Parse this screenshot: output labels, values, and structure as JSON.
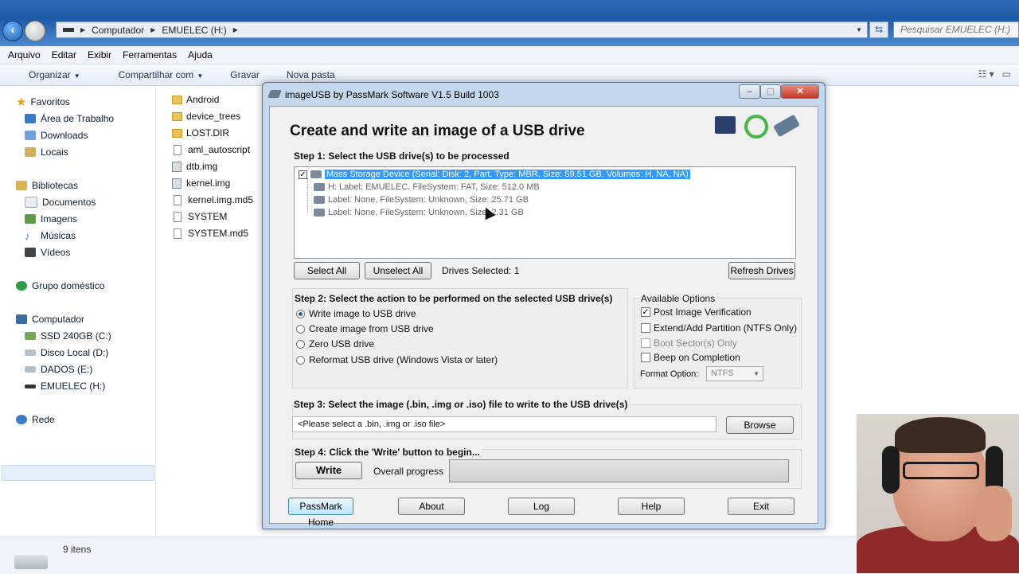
{
  "explorer": {
    "breadcrumb": [
      "Computador",
      "EMUELEC (H:)"
    ],
    "search_placeholder": "Pesquisar EMUELEC (H:)",
    "menu": [
      "Arquivo",
      "Editar",
      "Exibir",
      "Ferramentas",
      "Ajuda"
    ],
    "commands": [
      "Organizar",
      "Compartilhar com",
      "Gravar",
      "Nova pasta"
    ],
    "nav": {
      "favorites": "Favoritos",
      "desktop": "Área de Trabalho",
      "downloads": "Downloads",
      "places": "Locais",
      "libraries": "Bibliotecas",
      "documents": "Documentos",
      "images": "Imagens",
      "music": "Músicas",
      "videos": "Vídeos",
      "homegroup": "Grupo doméstico",
      "computer": "Computador",
      "drive_c": "SSD 240GB (C:)",
      "drive_d": "Disco Local (D:)",
      "drive_e": "DADOS (E:)",
      "drive_h": "EMUELEC (H:)",
      "network": "Rede"
    },
    "files": [
      "Android",
      "device_trees",
      "LOST.DIR",
      "aml_autoscript",
      "dtb.img",
      "kernel.img",
      "kernel.img.md5",
      "SYSTEM",
      "SYSTEM.md5"
    ],
    "status": "9 itens"
  },
  "dialog": {
    "title": "imageUSB by PassMark Software V1.5 Build 1003",
    "heading": "Create and write an image of a USB drive",
    "step1": "Step 1:  Select the USB drive(s) to be processed",
    "tree": {
      "root": "Mass Storage Device (Serial:  Disk: 2, Part. Type: MBR, Size: 59.51 GB, Volumes: H, NA, NA)",
      "child1": "H: Label: EMUELEC, FileSystem: FAT, Size: 512.0 MB",
      "child2": "Label: None, FileSystem: Unknown, Size: 25.71 GB",
      "child3": "Label: None, FileSystem: Unknown, Size: 2.31 GB"
    },
    "select_all": "Select All",
    "unselect_all": "Unselect All",
    "drives_selected": "Drives Selected: 1",
    "refresh_drives": "Refresh Drives",
    "step2": "Step 2: Select the action to be performed on the selected USB drive(s)",
    "actions": [
      "Write image to USB drive",
      "Create image from USB drive",
      "Zero USB drive",
      "Reformat USB drive (Windows Vista or later)"
    ],
    "selected_action_index": 0,
    "available_options": "Available Options",
    "options": {
      "post_verify": "Post Image Verification",
      "extend": "Extend/Add Partition (NTFS Only)",
      "boot_sector": "Boot Sector(s) Only",
      "beep": "Beep on Completion"
    },
    "format_option_label": "Format Option:",
    "format_option_value": "NTFS",
    "step3": "Step 3: Select the image (.bin, .img or .iso) file to write to the USB drive(s)",
    "file_input": "<Please select a .bin, .img or .iso file>",
    "browse": "Browse",
    "step4": "Step 4: Click the 'Write' button to begin...",
    "write": "Write",
    "overall_progress": "Overall progress",
    "progress_value": 0,
    "footer": [
      "PassMark Home",
      "About",
      "Log",
      "Help",
      "Exit"
    ],
    "window_buttons": {
      "minimize": "‒",
      "maximize": "▢",
      "close": "✕"
    }
  }
}
